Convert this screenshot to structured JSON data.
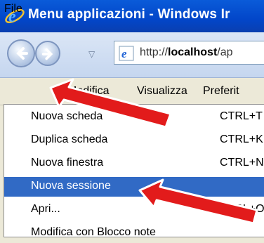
{
  "window": {
    "title": "Menu applicazioni - Windows Ir"
  },
  "address_bar": {
    "prefix": "http://",
    "host": "localhost",
    "path": "/ap"
  },
  "menubar": {
    "file": "File",
    "modifica": "Modifica",
    "visualizza": "Visualizza",
    "preferiti": "Preferit"
  },
  "file_menu": {
    "items": [
      {
        "label": "Nuova scheda",
        "shortcut": "CTRL+T"
      },
      {
        "label": "Duplica scheda",
        "shortcut": "CTRL+K"
      },
      {
        "label": "Nuova finestra",
        "shortcut": "CTRL+N"
      },
      {
        "label": "Nuova sessione",
        "shortcut": ""
      },
      {
        "label": "Apri...",
        "shortcut": "CTRL+O"
      },
      {
        "label": "Modifica con Blocco note",
        "shortcut": ""
      }
    ]
  },
  "colors": {
    "title_bar": "#0a5bd9",
    "highlight": "#316ac5",
    "annotation_arrow": "#e21b1b"
  }
}
